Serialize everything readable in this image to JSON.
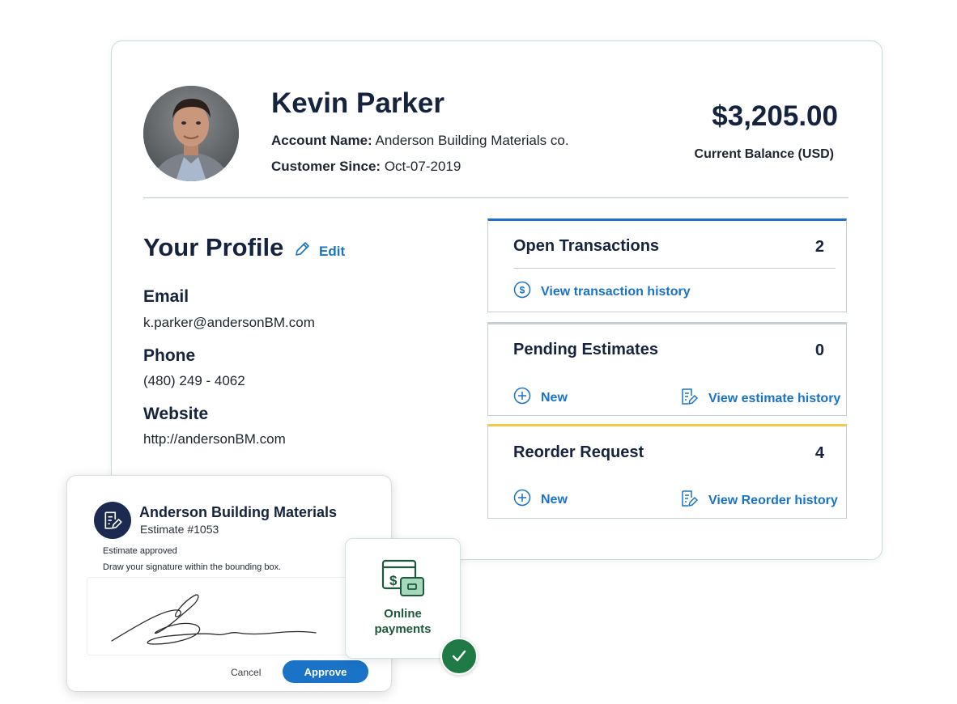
{
  "customer": {
    "name": "Kevin Parker",
    "account_name_label": "Account Name:",
    "account_name": "Anderson Building Materials co.",
    "customer_since_label": "Customer Since:",
    "customer_since": "Oct-07-2019"
  },
  "balance": {
    "amount": "$3,205.00",
    "label": "Current Balance (USD)"
  },
  "profile": {
    "title": "Your Profile",
    "edit_label": "Edit",
    "email_label": "Email",
    "email": "k.parker@andersonBM.com",
    "phone_label": "Phone",
    "phone": "(480) 249 - 4062",
    "website_label": "Website",
    "website": "http://andersonBM.com"
  },
  "panels": {
    "open_transactions": {
      "title": "Open Transactions",
      "count": "2",
      "link": "View transaction history",
      "accent": "#1a73c7"
    },
    "pending_estimates": {
      "title": "Pending Estimates",
      "count": "0",
      "new_label": "New",
      "history_link": "View estimate history",
      "accent": "#c5d0d3"
    },
    "reorder_request": {
      "title": "Reorder Request",
      "count": "4",
      "new_label": "New",
      "history_link": "View Reorder history",
      "accent": "#f2c94c"
    }
  },
  "estimate_card": {
    "company": "Anderson Building Materials",
    "estimate_number": "Estimate #1053",
    "status": "Estimate approved",
    "instruction": "Draw your signature within the bounding box.",
    "cancel_label": "Cancel",
    "approve_label": "Approve"
  },
  "online_payments": {
    "label_line1": "Online",
    "label_line2": "payments"
  },
  "colors": {
    "brand_blue": "#1a73c7",
    "navy": "#16233f",
    "success_green": "#1f7a45"
  },
  "icons": [
    "avatar-photo",
    "pencil-icon",
    "dollar-circle-icon",
    "plus-circle-icon",
    "document-edit-icon",
    "payment-card-icon",
    "check-icon"
  ]
}
